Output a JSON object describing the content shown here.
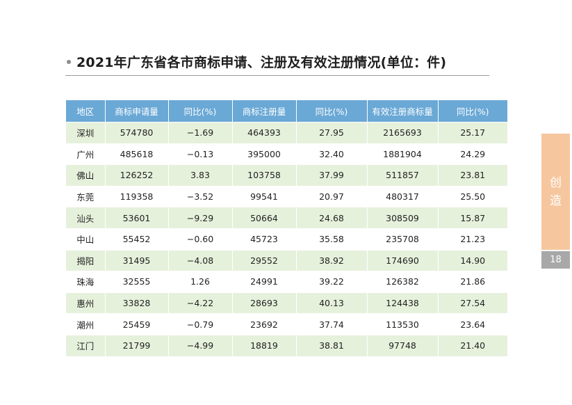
{
  "title": "2021年广东省各市商标申请、注册及有效注册情况(单位：件)",
  "table": {
    "headers": [
      "地区",
      "商标申请量",
      "同比(%)",
      "商标注册量",
      "同比(%)",
      "有效注册商标量",
      "同比(%)"
    ],
    "rows": [
      [
        "深圳",
        "574780",
        "−1.69",
        "464393",
        "27.95",
        "2165693",
        "25.17"
      ],
      [
        "广州",
        "485618",
        "−0.13",
        "395000",
        "32.40",
        "1881904",
        "24.29"
      ],
      [
        "佛山",
        "126252",
        "3.83",
        "103758",
        "37.99",
        "511857",
        "23.81"
      ],
      [
        "东莞",
        "119358",
        "−3.52",
        "99541",
        "20.97",
        "480317",
        "25.50"
      ],
      [
        "汕头",
        "53601",
        "−9.29",
        "50664",
        "24.68",
        "308509",
        "15.87"
      ],
      [
        "中山",
        "55452",
        "−0.60",
        "45723",
        "35.58",
        "235708",
        "21.23"
      ],
      [
        "揭阳",
        "31495",
        "−4.08",
        "29552",
        "38.92",
        "174690",
        "14.90"
      ],
      [
        "珠海",
        "32555",
        "1.26",
        "24991",
        "39.22",
        "126382",
        "21.86"
      ],
      [
        "惠州",
        "33828",
        "−4.22",
        "28693",
        "40.13",
        "124438",
        "27.54"
      ],
      [
        "潮州",
        "25459",
        "−0.79",
        "23692",
        "37.74",
        "113530",
        "23.64"
      ],
      [
        "江门",
        "21799",
        "−4.99",
        "18819",
        "38.81",
        "97748",
        "21.40"
      ]
    ]
  },
  "side_tab": {
    "char1": "创",
    "char2": "造"
  },
  "page_number": "18",
  "colors": {
    "header": "#6aa8d6",
    "row_stripe": "#e6f1dc",
    "side_tab": "#f6c79f",
    "page_badge": "#a8a8a8"
  }
}
